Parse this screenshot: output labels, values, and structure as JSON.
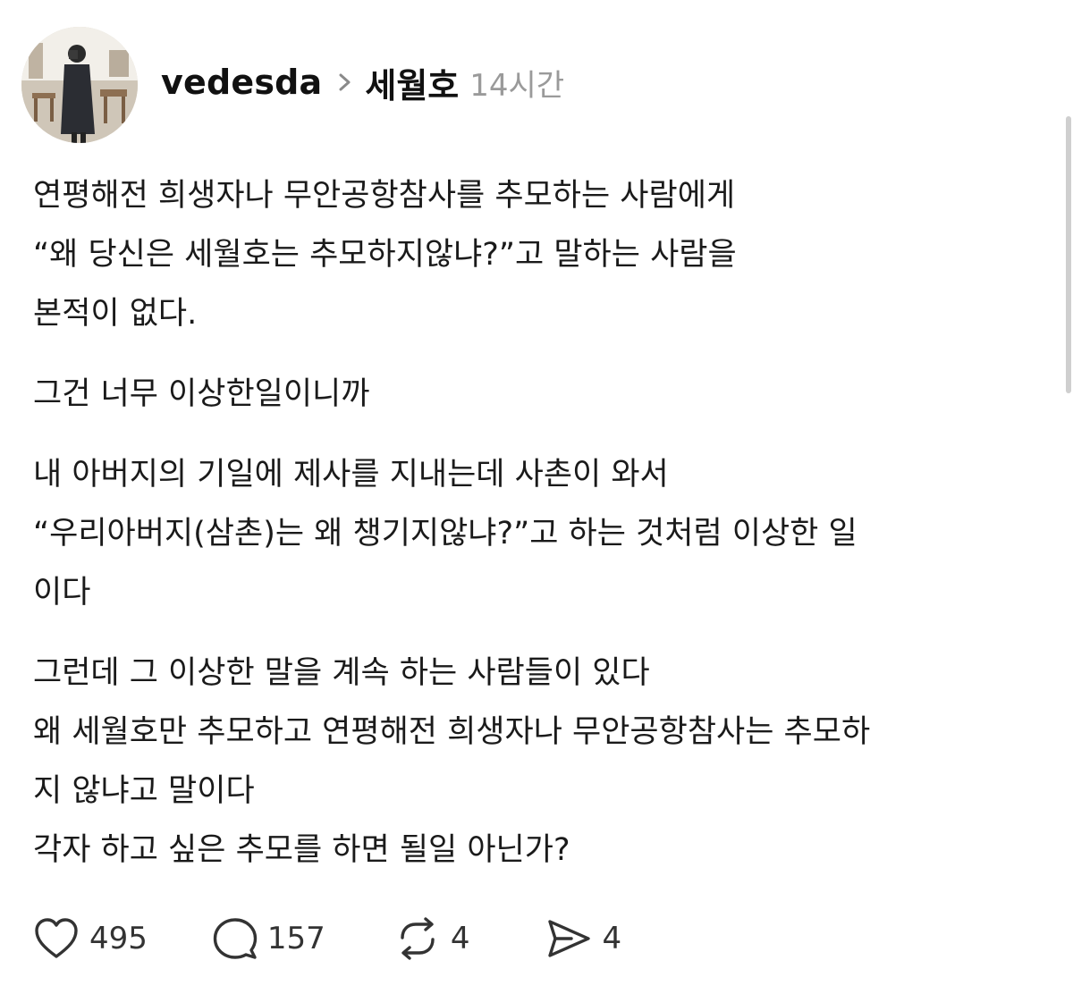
{
  "header": {
    "username": "vedesda",
    "community": "세월호",
    "time": "14시간"
  },
  "icons": {
    "avatar": "avatar",
    "chevron": "chevron-right-icon",
    "like": "heart-icon",
    "comment": "comment-bubble-icon",
    "repost": "repost-icon",
    "share": "send-icon"
  },
  "content": {
    "paragraphs": [
      {
        "lines": [
          "연평해전 희생자나 무안공항참사를 추모하는 사람에게",
          "“왜 당신은 세월호는 추모하지않냐?”고 말하는 사람을",
          "본적이 없다."
        ]
      },
      {
        "lines": [
          "그건 너무 이상한일이니까"
        ]
      },
      {
        "lines": [
          "내 아버지의 기일에 제사를 지내는데 사촌이 와서",
          "“우리아버지(삼촌)는 왜 챙기지않냐?”고 하는 것처럼 이상한 일",
          "이다"
        ]
      },
      {
        "lines": [
          "그런데 그 이상한 말을 계속 하는 사람들이 있다",
          "왜 세월호만 추모하고 연평해전 희생자나 무안공항참사는 추모하",
          "지 않냐고 말이다",
          "각자 하고 싶은 추모를 하면 될일 아닌가?"
        ]
      }
    ]
  },
  "actions": {
    "likes": "495",
    "comments": "157",
    "reposts": "4",
    "shares": "4"
  },
  "colors": {
    "text": "#1a1a1a",
    "muted": "#9a9a9a",
    "background": "#ffffff"
  }
}
